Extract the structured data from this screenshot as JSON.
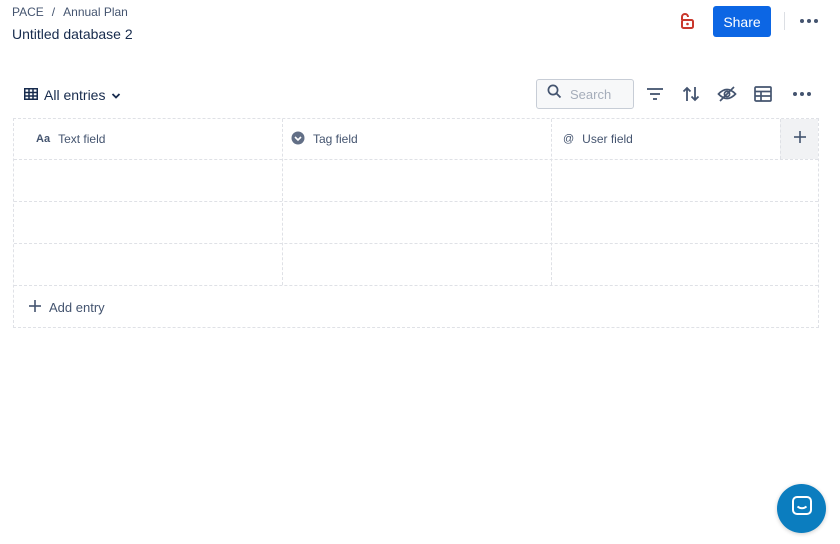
{
  "breadcrumb": {
    "items": [
      {
        "label": "PACE"
      },
      {
        "label": "/"
      },
      {
        "label": "Annual Plan"
      }
    ]
  },
  "page": {
    "title": "Untitled database 2"
  },
  "header": {
    "share_label": "Share",
    "accent": "#0c66e4"
  },
  "toolbar": {
    "view_label": "All entries",
    "search_placeholder": "Search"
  },
  "table": {
    "columns": [
      {
        "label": "Text field",
        "icon": "text-type-icon"
      },
      {
        "label": "Tag field",
        "icon": "tag-icon"
      },
      {
        "label": "User field",
        "icon": "at-sign-icon"
      }
    ],
    "row_count": 3,
    "add_entry_label": "Add entry"
  }
}
